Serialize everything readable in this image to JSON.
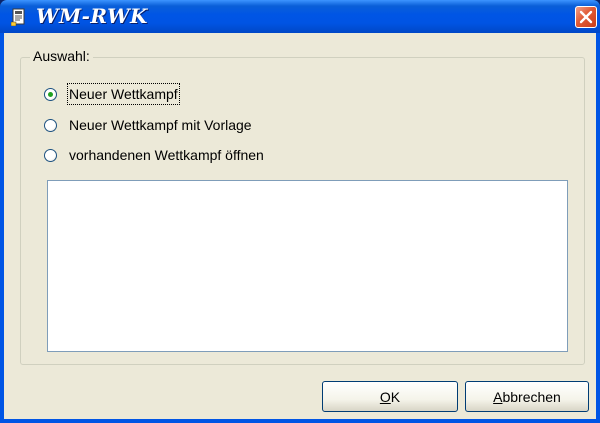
{
  "window": {
    "title": "WM-RWK"
  },
  "group": {
    "label": "Auswahl:"
  },
  "options": [
    {
      "label": "Neuer Wettkampf",
      "selected": true
    },
    {
      "label": "Neuer Wettkampf mit Vorlage",
      "selected": false
    },
    {
      "label": "vorhandenen Wettkampf öffnen",
      "selected": false
    }
  ],
  "buttons": {
    "ok_mnemonic": "O",
    "ok_rest": "K",
    "cancel_mnemonic": "A",
    "cancel_rest": "bbrechen"
  },
  "colors": {
    "titlebar": "#0054e3",
    "dialog_face": "#ece9d8",
    "close_button": "#e05a35"
  },
  "icons": {
    "app": "document-icon",
    "close": "close-icon"
  }
}
